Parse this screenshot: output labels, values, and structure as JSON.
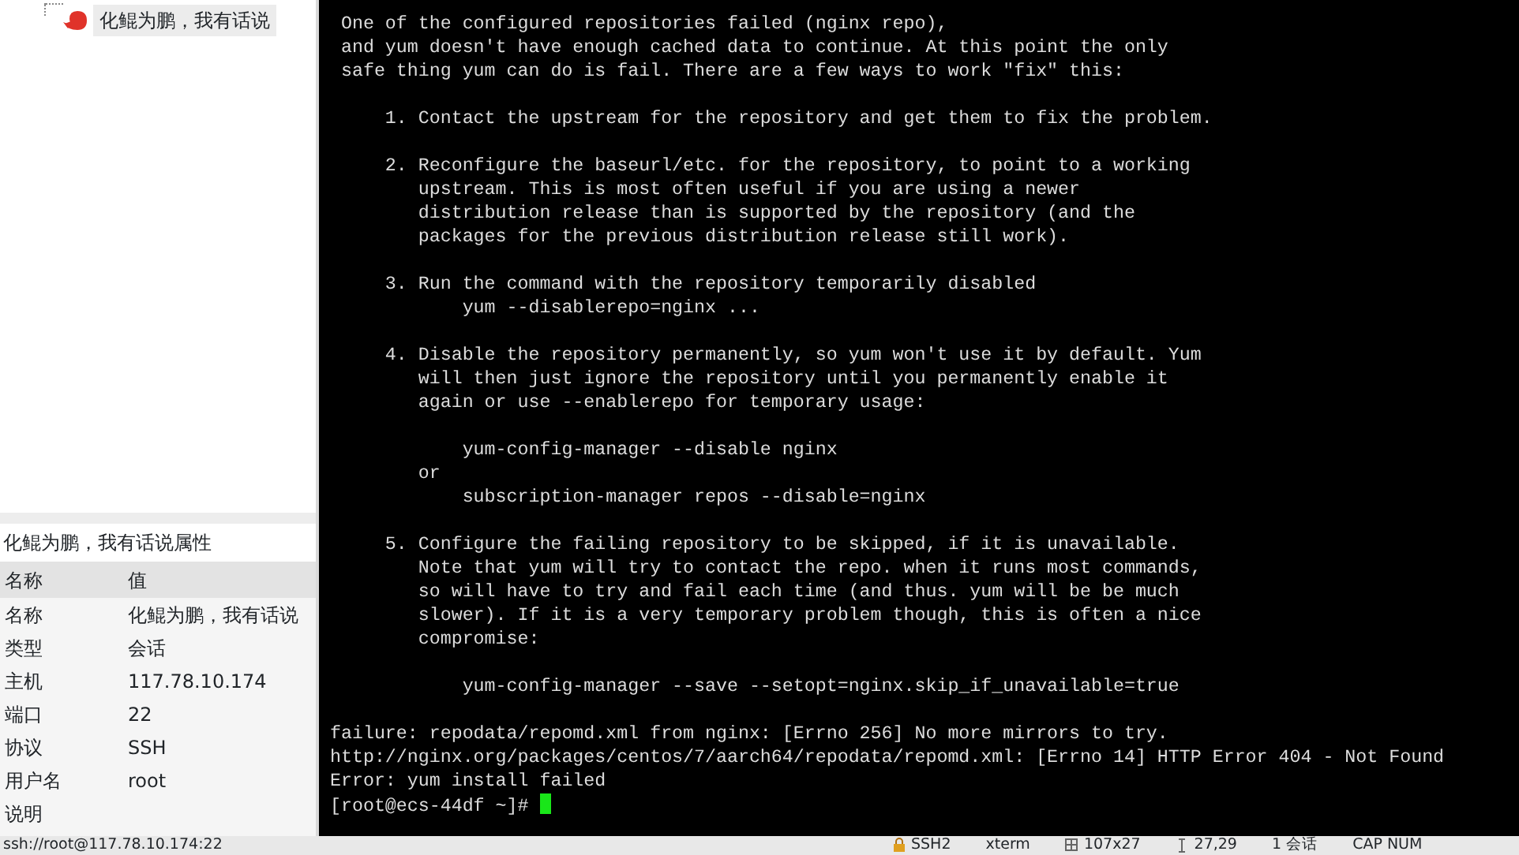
{
  "session_tree": {
    "items": [
      {
        "label": "化鲲为鹏，我有话说",
        "selected": true
      }
    ]
  },
  "properties": {
    "title": "化鲲为鹏，我有话说属性",
    "columns": [
      "名称",
      "值"
    ],
    "rows": [
      {
        "name": "名称",
        "value": "化鲲为鹏，我有话说"
      },
      {
        "name": "类型",
        "value": "会话"
      },
      {
        "name": "主机",
        "value": "117.78.10.174"
      },
      {
        "name": "端口",
        "value": "22"
      },
      {
        "name": "协议",
        "value": "SSH"
      },
      {
        "name": "用户名",
        "value": "root"
      },
      {
        "name": "说明"
      }
    ]
  },
  "terminal": {
    "cursor": true,
    "paragraphs": [
      [
        " One of the configured repositories failed (nginx repo),",
        " and yum doesn't have enough cached data to continue. At this point the only",
        " safe thing yum can do is fail. There are a few ways to work \"fix\" this:"
      ],
      [
        "     1. Contact the upstream for the repository and get them to fix the problem."
      ],
      [
        "     2. Reconfigure the baseurl/etc. for the repository, to point to a working",
        "        upstream. This is most often useful if you are using a newer",
        "        distribution release than is supported by the repository (and the",
        "        packages for the previous distribution release still work)."
      ],
      [
        "     3. Run the command with the repository temporarily disabled",
        "            yum --disablerepo=nginx ..."
      ],
      [
        "     4. Disable the repository permanently, so yum won't use it by default. Yum",
        "        will then just ignore the repository until you permanently enable it",
        "        again or use --enablerepo for temporary usage:"
      ],
      [
        "            yum-config-manager --disable nginx",
        "        or",
        "            subscription-manager repos --disable=nginx"
      ],
      [
        "     5. Configure the failing repository to be skipped, if it is unavailable.",
        "        Note that yum will try to contact the repo. when it runs most commands,",
        "        so will have to try and fail each time (and thus. yum will be be much",
        "        slower). If it is a very temporary problem though, this is often a nice",
        "        compromise:"
      ],
      [
        "            yum-config-manager --save --setopt=nginx.skip_if_unavailable=true"
      ],
      [
        "failure: repodata/repomd.xml from nginx: [Errno 256] No more mirrors to try.",
        "http://nginx.org/packages/centos/7/aarch64/repodata/repomd.xml: [Errno 14] HTTP Error 404 - Not Found",
        "Error: yum install failed",
        "[root@ecs-44df ~]# "
      ]
    ]
  },
  "status_bar": {
    "address": "ssh://root@117.78.10.174:22",
    "items": [
      {
        "kind": "lock",
        "text": "SSH2"
      },
      {
        "kind": "plain",
        "text": "xterm"
      },
      {
        "kind": "size",
        "text": "107x27"
      },
      {
        "kind": "cursor",
        "text": "27,29"
      },
      {
        "kind": "plain",
        "text": "1 会话"
      },
      {
        "kind": "plain",
        "text": "CAP NUM"
      }
    ]
  }
}
